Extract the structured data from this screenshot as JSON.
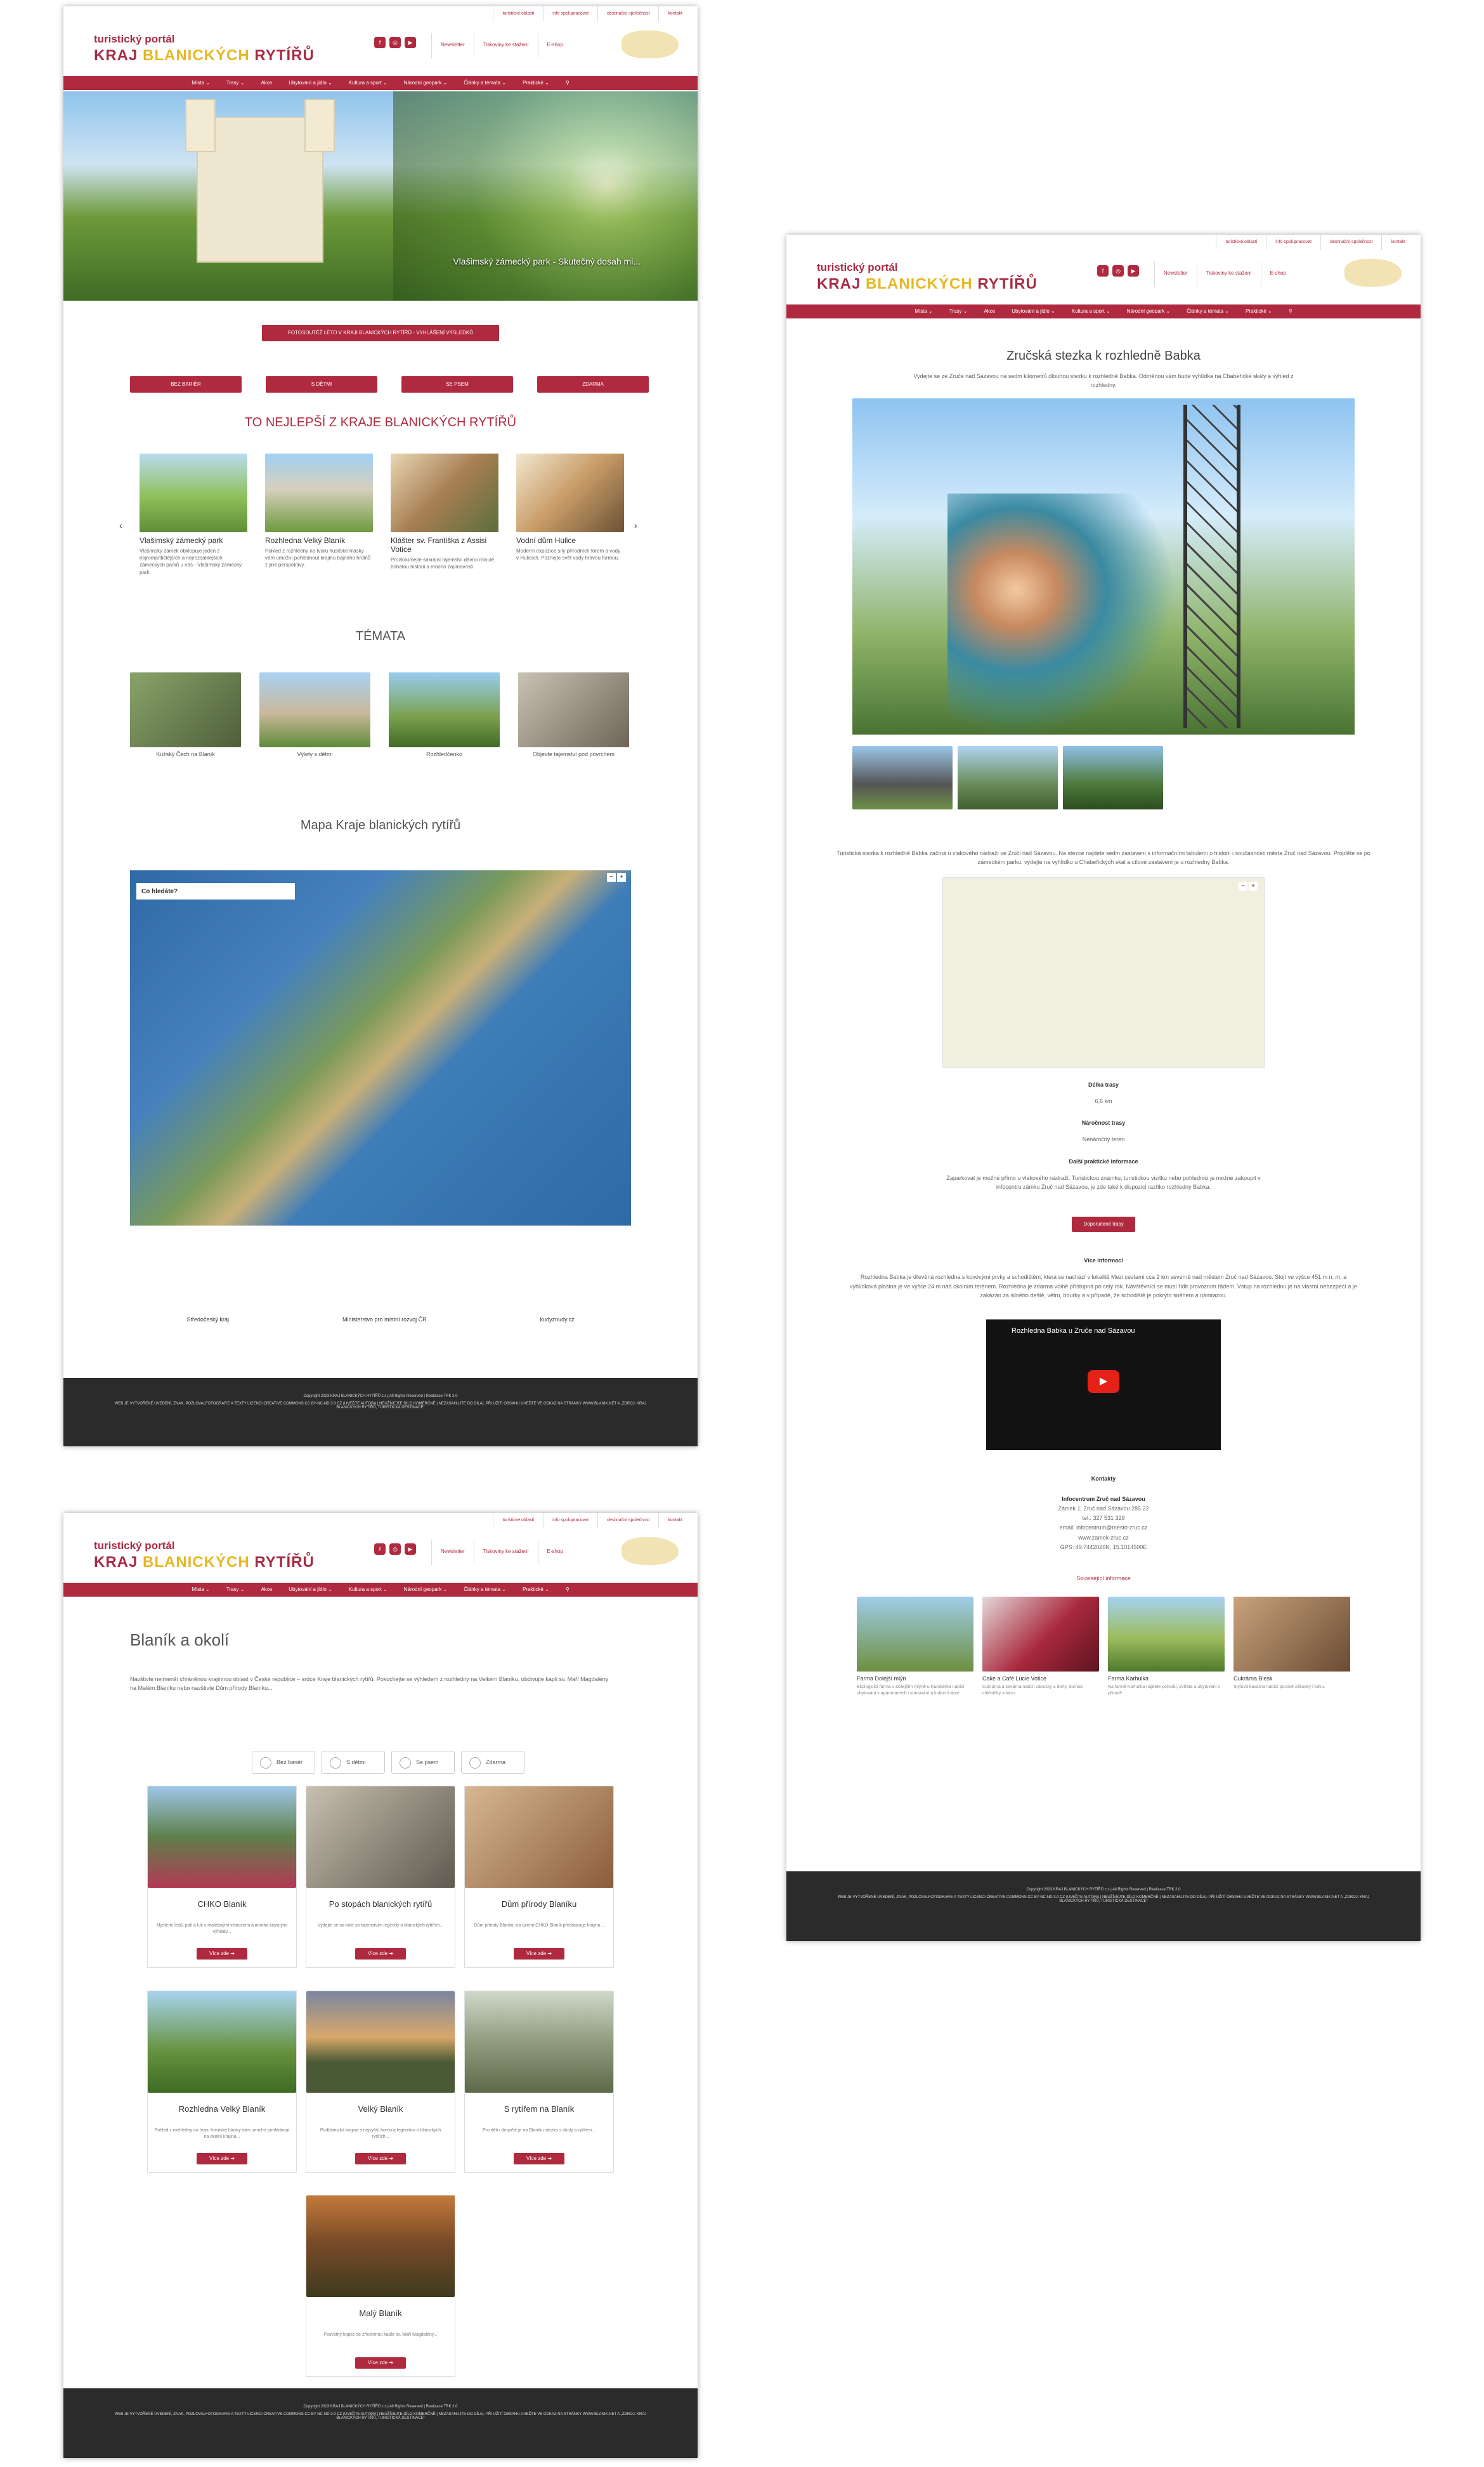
{
  "common": {
    "top_links": [
      "turistické oblasti",
      "info spolupracovat",
      "destinační společnost",
      "kontakt"
    ],
    "logo_line1": "turistický portál",
    "logo_kraj": "KRAJ",
    "logo_mid": "BLANICKÝCH",
    "logo_end": "RYTÍŘŮ",
    "header_links": [
      "Newsletter",
      "Tiskoviny ke stažení",
      "E-shop"
    ],
    "social_icons": [
      "facebook-icon",
      "instagram-icon",
      "youtube-icon"
    ],
    "nav": [
      "Místa ⌄",
      "Trasy ⌄",
      "Akce",
      "Ubytování a jídlo ⌄",
      "Kultura a sport ⌄",
      "Národní geopark ⌄",
      "Články a témata ⌄",
      "Praktické ⌄",
      "⚲"
    ],
    "footer_copy": "Copyright 2023 KRAJ BLANICKÝCH RYTÍŘŮ z.s.| All Rights Reserved | Realizace TRK 2.0",
    "footer_note": "WEB JE VYTVOŘENÉ UVEDENÍ, ZNAK, POZLOVALFOTOGRAFIE A TEXTY LICENCI CREATIVE COMMONS CC BY-NC-ND 3.0 CZ (UVEĎTE AUTORA | NEUŽÍVEJTE DÍLO KOMERČNĚ | NEZASAHUJTE DO DÍLA). PŘI UŽITÍ OBSAHU UVEĎTE VE ODKAZ NA STRÁNKY WWW.BLANIK.NET A „ZDROJ: KRAJ BLANICKÝCH RYTÍŘŮ, TURISTICKÁ DESTINACE“"
  },
  "home": {
    "hero_caption": "Vlašimský zámecký park - Skutečný dosah mi...",
    "cta": "FOTOSOUTĚŽ LÉTO V KRAJI BLANICKÝCH RYTÍŘŮ - VYHLÁŠENÍ VÝSLEDKŮ",
    "filters": [
      "BEZ BARIÉR",
      "S DĚTMI",
      "SE PSEM",
      "ZDARMA"
    ],
    "best_title": "TO NEJLEPŠÍ Z KRAJE BLANICKÝCH RYTÍŘŮ",
    "best": [
      {
        "t": "Vlašimský zámecký park",
        "d": "Vlašimský zámek obklopuje jeden z nejromantičtějších a nejrozsáhlejších zámeckých parků u nás - Vlašimský zámecký park."
      },
      {
        "t": "Rozhledna Velký Blaník",
        "d": "Pohled z rozhledny na tvaru husitské hlásky vám umožní pohlédnout krajinu bájného hrdinů z jiné perspektivy."
      },
      {
        "t": "Klášter sv. Františka z Assisi Votice",
        "d": "Prozkoumejte sakrální tajemství dávno minulé, bohatou historii a mnoho zajímavostí."
      },
      {
        "t": "Vodní dům Hulice",
        "d": "Moderní expozice síly přírodních forem a vody v Hulicích. Poznejte svět vody hravou formou."
      }
    ],
    "temata_title": "TÉMATA",
    "temata": [
      "Kužský Čech na Blaník",
      "Výlety s dětmi",
      "Rozhledčenko",
      "Objevte tajemství pod povrchem"
    ],
    "map_title": "Mapa Kraje blanických rytířů",
    "map_search": "Co hledáte?",
    "partners": [
      "Středočeský kraj",
      "Ministerstvo pro místní rozvoj ČR",
      "kudyznudy.cz"
    ]
  },
  "detail": {
    "title": "Zručská stezka k rozhledně Babka",
    "intro": "Vydejte se ze Zruče nad Sázavou na sedm kilometrů dlouhou stezku k rozhledně Babka. Odměnou vám bude vyhlídka na Chabeřické skály a výhled z rozhledny.",
    "text": "Turistická stezka k rozhledně Babka začíná u vlakového nádraží ve Zruči nad Sázavou. Na stezce najdete sedm zastavení s informačními tabulemi o historii i současnosti města Zruč nad Sázavou. Projděte se po zámeckém parku, vydejte na vyhlídku u Chabeřických skal a cílové zastavení je u rozhledny Babka.",
    "len_label": "Délka trasy",
    "len": "6,6 km",
    "diff_label": "Náročnost trasy",
    "diff": "Nenáročný terén",
    "more_label": "Další praktické informace",
    "more": "Zaparkovat je možné přímo u vlakového nádraží. Turistickou známku, turistickou vizitku nebo pohlednici je možné zakoupit v infocentru zámku Zruč nad Sázavou, je zde také k dispozici razítko rozhledny Babka.",
    "btn": "Doporučené trasy",
    "vice_label": "Více informací",
    "vice": "Rozhledna Babka je dřevěná rozhledna s kovovými prvky a schodištěm, která se nachází v lokalitě Mezi cestami cca 2 km severně nad městem Zruč nad Sázavou. Stojí ve výšce 451 m n. m. a vyhlídková plošina je ve výšce 24 m nad okolním terénem. Rozhledna je zdarma volně přístupná po celý rok. Návštěvníci se musí řídit provozním řádem. Vstup na rozhlednu je na vlastní nebezpečí a je zakázán za silného deště, větru, bouřky a v případě, že schodiště je pokryto sněhem a námrazou.",
    "video_title": "Rozhledna Babka u Zruče nad Sázavou",
    "kontakt_label": "Kontakty",
    "kontakt": [
      "Infocentrum Zruč nad Sázavou",
      "Zámek 1, Zruč nad Sázavou 285 22",
      "tel.: 327 531 329",
      "email: infocentrum@mesto-zruc.cz",
      "www.zamek-zruc.cz",
      "GPS: 49.7442026N, 15.1014500E"
    ],
    "related_label": "Související informace",
    "related": [
      {
        "t": "Farma Dolejší mlýn",
        "d": "Ekologická farma v Dolejším mlýně u Kamberka nabízí ubytování v apartmánech i stanování a kulturní akce."
      },
      {
        "t": "Cake a Café Lucie Votice",
        "d": "Cukrárna a kavárna nabízí zákusky a dorty, domácí chlebíčky a kávu."
      },
      {
        "t": "Farma Karhulka",
        "d": "Na farmě Karhulka najdete pohodu, zvířata a ubytování v přírodě."
      },
      {
        "t": "Cukrárna Blesk",
        "d": "Stylová kavárna nabízí poctivé zákusky i kávu."
      }
    ]
  },
  "listing": {
    "title": "Blaník a okolí",
    "intro": "Navštivte nejmenší chráněnou krajinnou oblast v České republice – srdce Kraje blanických rytířů. Pokochejte se výhledem z rozhledny na Velkém Blaníku, obdivujte kapli sv. Maří Magdalény na Malém Blaníku nebo navštivte Dům přírody Blaníku...",
    "filters": [
      "Bez bariér",
      "S dětmi",
      "Se psem",
      "Zdarma"
    ],
    "cards": [
      {
        "t": "CHKO Blaník",
        "d": "Mysterie lesů, polí a luk s malebnými vesnicemi a mnoha krásnými výhledy..."
      },
      {
        "t": "Po stopách blanických rytířů",
        "d": "Vydejte se na kole za tajemstvím legendy o blanických rytířích..."
      },
      {
        "t": "Dům přírody Blaníku",
        "d": "Dům přírody Blaníku na území CHKO Blaník představuje krajinu..."
      },
      {
        "t": "Rozhledna Velký Blaník",
        "d": "Pohled z rozhledny na tvaru husitské hlásky vám umožní pohlédnout na okolní krajinu..."
      },
      {
        "t": "Velký Blaník",
        "d": "Podblanická krajina s nejvyšší horou a legendou o blanických rytířích..."
      },
      {
        "t": "S rytířem na Blaník",
        "d": "Pro děti i dospělé je na Blaníku stezka s úkoly a rytířem..."
      },
      {
        "t": "Malý Blaník",
        "d": "Posvátný kopec se zříceninou kaple sv. Maří Magdalény..."
      }
    ],
    "more_btn": "Více zde ➜"
  }
}
